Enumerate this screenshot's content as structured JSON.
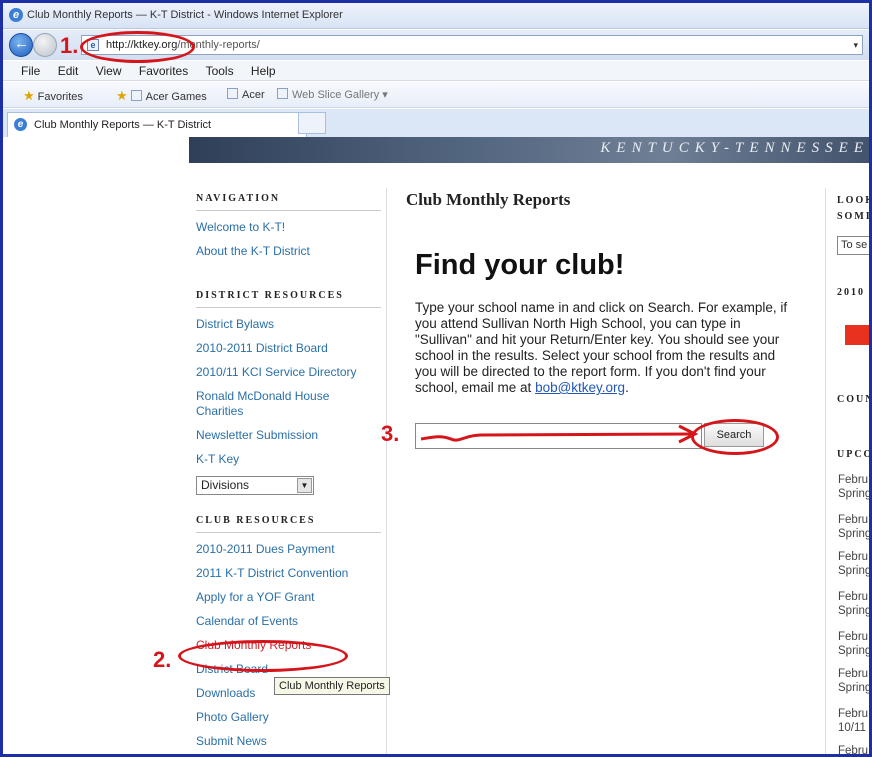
{
  "browser": {
    "window_title": "Club Monthly Reports — K-T District - Windows Internet Explorer",
    "url_host": "http://ktkey.org",
    "url_path": "/monthly-reports/",
    "menu": [
      "File",
      "Edit",
      "View",
      "Favorites",
      "Tools",
      "Help"
    ],
    "favorites_label": "Favorites",
    "favorites_items": [
      "Acer Games",
      "Acer",
      "Web Slice Gallery ▾"
    ],
    "tab_title": "Club Monthly Reports — K-T District"
  },
  "header": {
    "slogan": "KENTUCKY-TENNESSEE"
  },
  "navigation": {
    "heading": "NAVIGATION",
    "items": [
      "Welcome to K-T!",
      "About the K-T District"
    ]
  },
  "district_resources": {
    "heading": "DISTRICT RESOURCES",
    "items": [
      "District Bylaws",
      "2010-2011 District Board",
      "2010/11 KCI Service Directory",
      "Ronald McDonald House Charities",
      "Newsletter Submission",
      "K-T Key"
    ],
    "select_value": "Divisions"
  },
  "club_resources": {
    "heading": "CLUB RESOURCES",
    "items": [
      "2010-2011 Dues Payment",
      "2011 K-T District Convention",
      "Apply for a YOF Grant",
      "Calendar of Events",
      "Club Monthly Reports",
      "District Board",
      "Downloads",
      "Photo Gallery",
      "Submit News"
    ]
  },
  "main": {
    "page_title": "Club Monthly Reports",
    "heading": "Find your club!",
    "body": "Type your school name in and click on Search. For example, if you attend Sullivan North High School, you can type in \"Sullivan\" and hit your Return/Enter key. You should see your school in the results. Select your school from the results and you will be directed to the report form. If you don't find your school, email me at ",
    "email": "bob@ktkey.org",
    "body_end": ".",
    "search_value": "",
    "search_button": "Search"
  },
  "right_column": {
    "heading1": "LOOK",
    "heading1b": "SOMI",
    "select_value": "To se",
    "heading2": "2010",
    "heading3": "COUN",
    "heading4": "UPCO",
    "events": [
      "Febru Spring",
      "Febru Spring",
      "Febru Spring",
      "Febru Spring",
      "Febru Spring",
      "Febru Spring",
      "Febru 10/11",
      "Febru"
    ]
  },
  "tooltip": "Club Monthly Reports",
  "annotations": {
    "step1": "1.",
    "step2": "2.",
    "step3": "3."
  },
  "colors": {
    "annotation": "#d6151b",
    "link": "#2a6fa8",
    "frame": "#1c2fa6"
  }
}
